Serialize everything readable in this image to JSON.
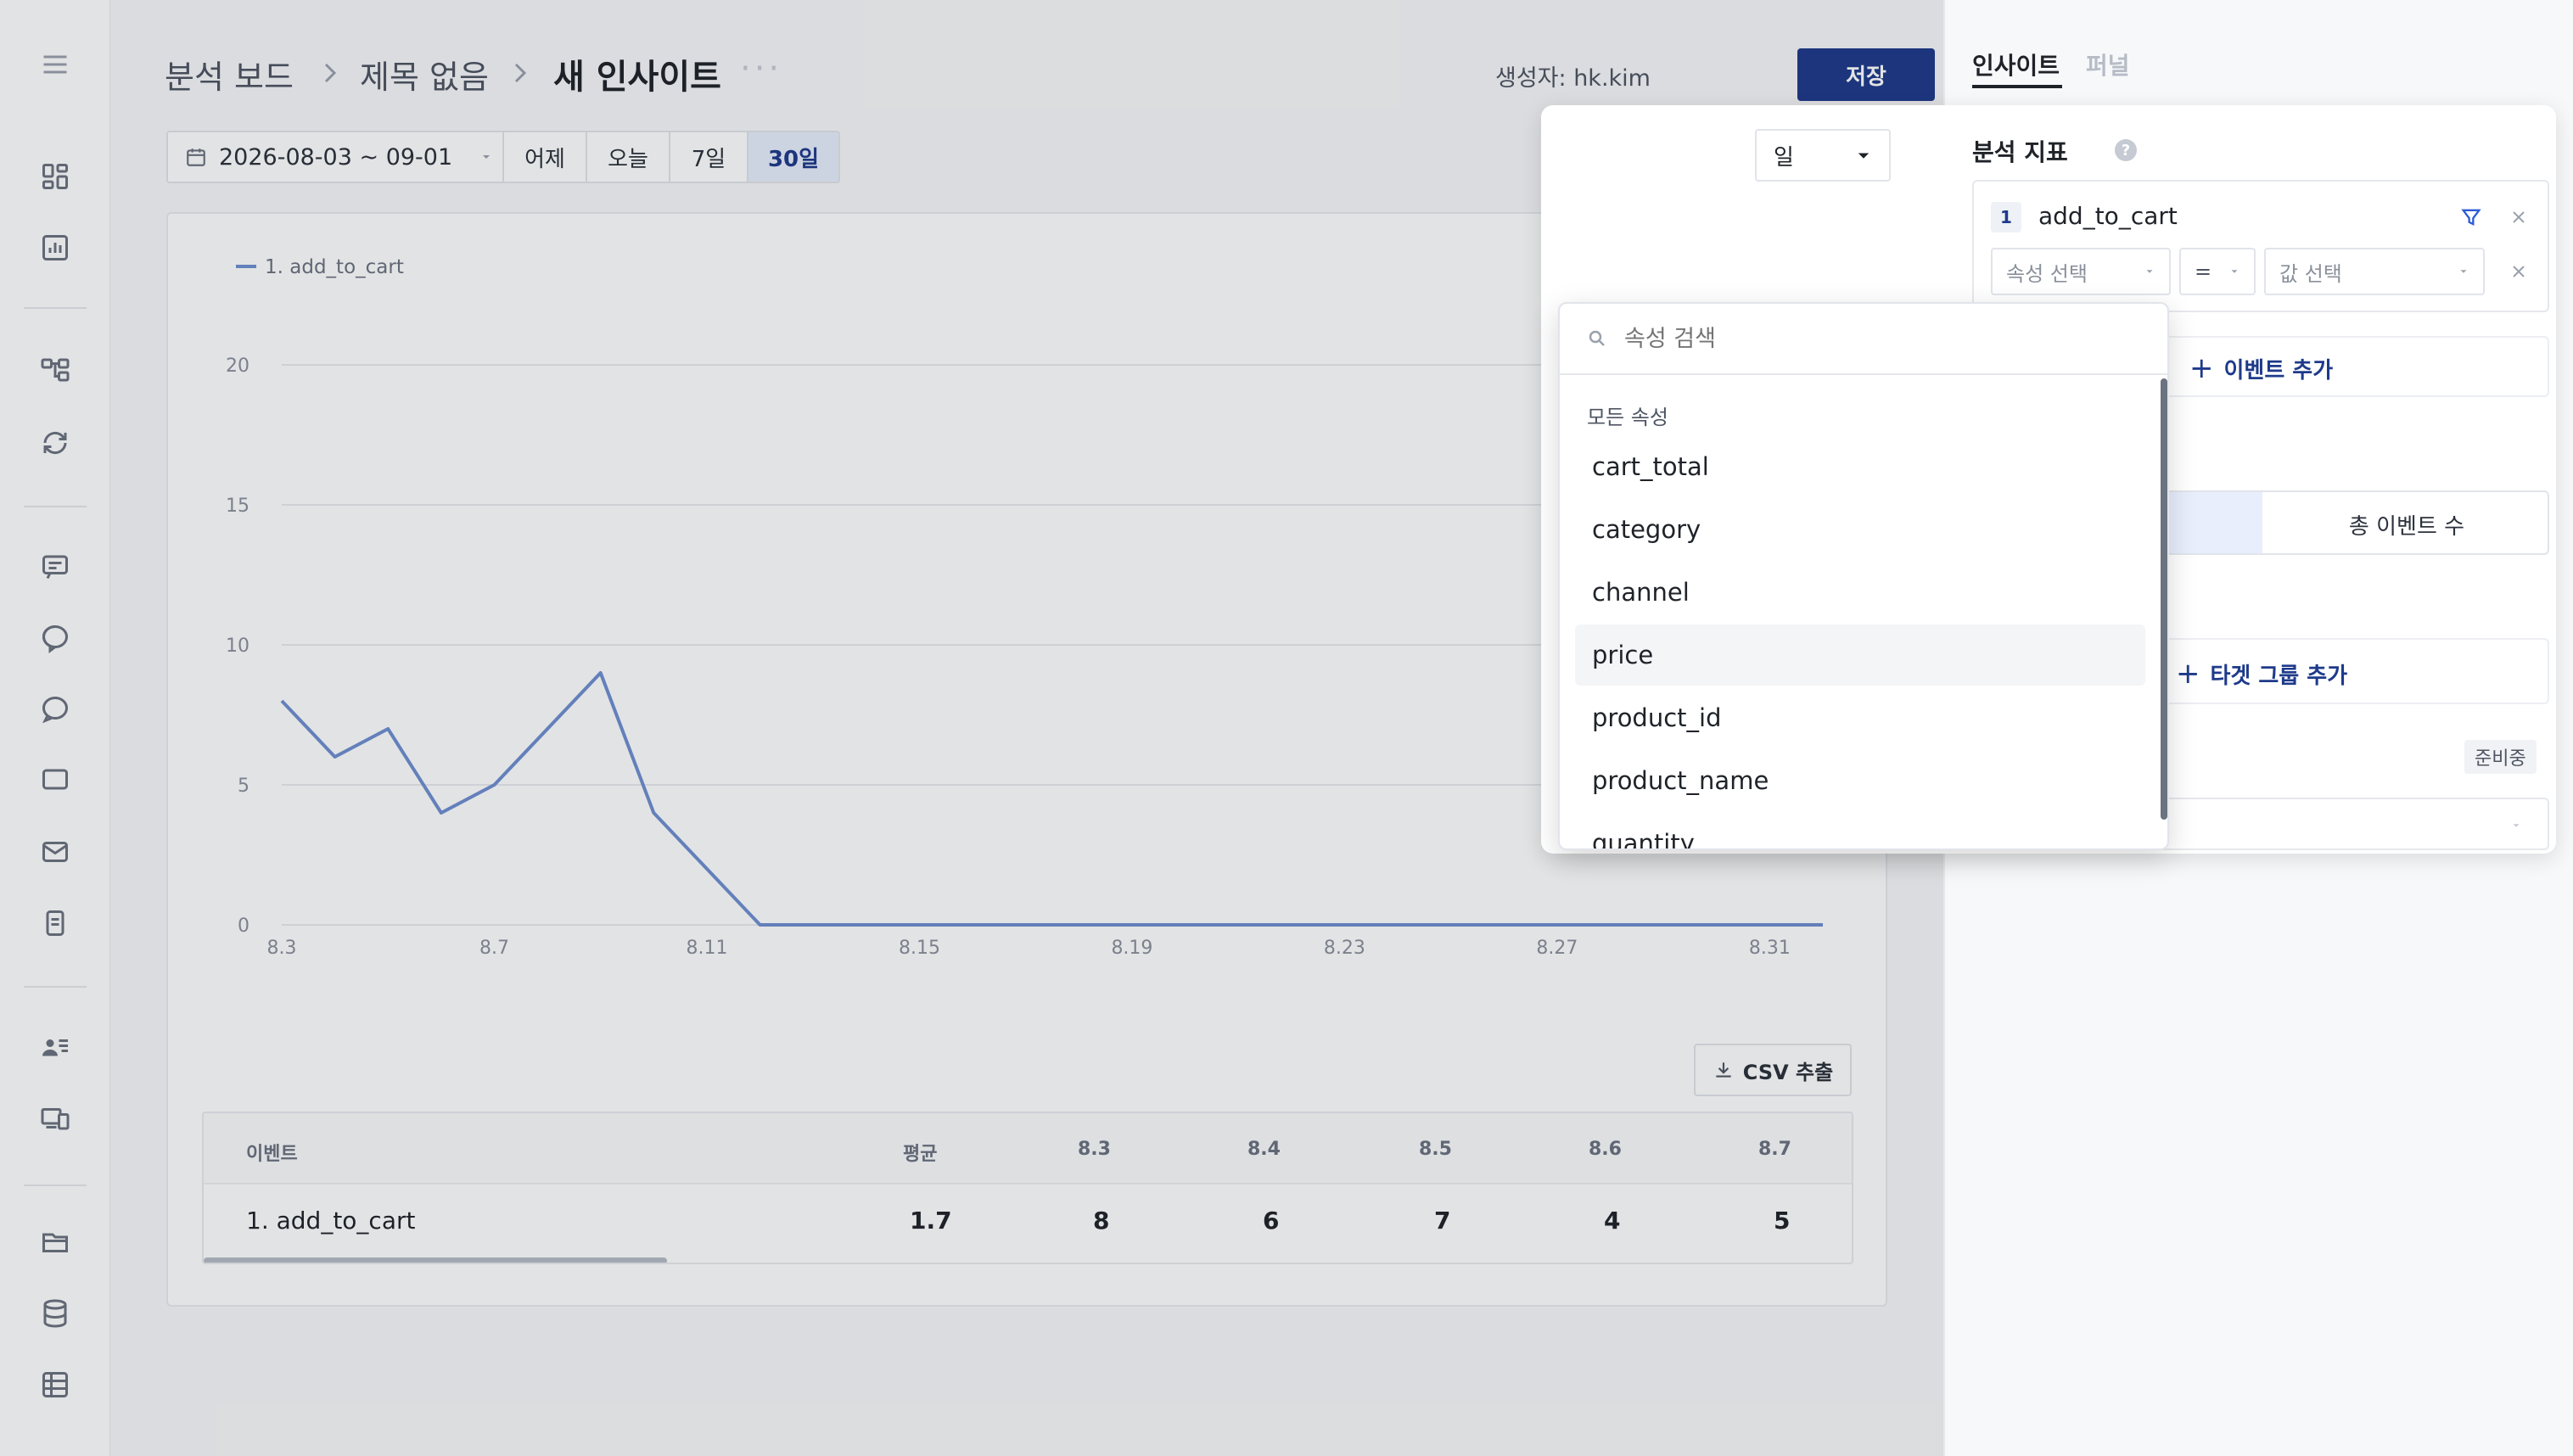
{
  "sidebar": {
    "icons": [
      "menu-icon",
      "dashboard-icon",
      "report-icon",
      "flow-icon",
      "sync-icon",
      "message-icon",
      "chat-icon",
      "chat-alt-icon",
      "comment-icon",
      "mail-icon",
      "document-icon",
      "user-list-icon",
      "device-icon",
      "folder-icon",
      "database-icon",
      "table-icon"
    ]
  },
  "header": {
    "breadcrumb": [
      "분석 보드",
      "제목 없음"
    ],
    "title": "새 인사이트",
    "more": "···",
    "creator": "생성자: hk.kim",
    "save_label": "저장"
  },
  "date_filter": {
    "range": "2026-08-03 ~ 09-01",
    "presets": [
      "어제",
      "오늘",
      "7일",
      "30일"
    ],
    "active": "30일"
  },
  "granularity": "일",
  "chart_data": {
    "type": "line",
    "series": [
      {
        "name": "1. add_to_cart",
        "x": [
          "8.3",
          "8.4",
          "8.5",
          "8.6",
          "8.7",
          "8.8",
          "8.9",
          "8.10",
          "8.11",
          "8.12",
          "8.13",
          "8.14",
          "8.15",
          "8.16",
          "8.17",
          "8.18",
          "8.19",
          "8.20",
          "8.21",
          "8.22",
          "8.23",
          "8.24",
          "8.25",
          "8.26",
          "8.27",
          "8.28",
          "8.29",
          "8.30",
          "8.31",
          "9.1"
        ],
        "values": [
          8,
          6,
          7,
          4,
          5,
          7,
          9,
          4,
          2,
          0,
          0,
          0,
          0,
          0,
          0,
          0,
          0,
          0,
          0,
          0,
          0,
          0,
          0,
          0,
          0,
          0,
          0,
          0,
          0,
          0
        ]
      }
    ],
    "x_ticks": [
      "8.3",
      "8.7",
      "8.11",
      "8.15",
      "8.19",
      "8.23",
      "8.27",
      "8.31"
    ],
    "y_ticks": [
      0,
      5,
      10,
      15,
      20
    ],
    "ylim": [
      0,
      20
    ],
    "grid": true,
    "legend": "top-left",
    "color": "#6f8fd1"
  },
  "csv_label": "CSV 추출",
  "table": {
    "headers": [
      "이벤트",
      "평균",
      "8.3",
      "8.4",
      "8.5",
      "8.6",
      "8.7"
    ],
    "rows": [
      [
        "1. add_to_cart",
        "1.7",
        "8",
        "6",
        "7",
        "4",
        "5"
      ]
    ]
  },
  "right_panel": {
    "tabs": [
      "인사이트",
      "퍼널"
    ],
    "active_tab": "인사이트",
    "section_title": "분석 지표",
    "event_index": "1",
    "event_name": "add_to_cart",
    "filter": {
      "property_placeholder": "속성 선택",
      "operator": "=",
      "value_placeholder": "값 선택"
    },
    "add_event": "이벤트 추가",
    "measure_option": "총 이벤트 수",
    "add_target_group": "타겟 그룹 추가",
    "preparing_badge": "준비중"
  },
  "property_dropdown": {
    "search_placeholder": "속성 검색",
    "section": "모든 속성",
    "options": [
      "cart_total",
      "category",
      "channel",
      "price",
      "product_id",
      "product_name",
      "quantity"
    ],
    "hovered": "price"
  }
}
